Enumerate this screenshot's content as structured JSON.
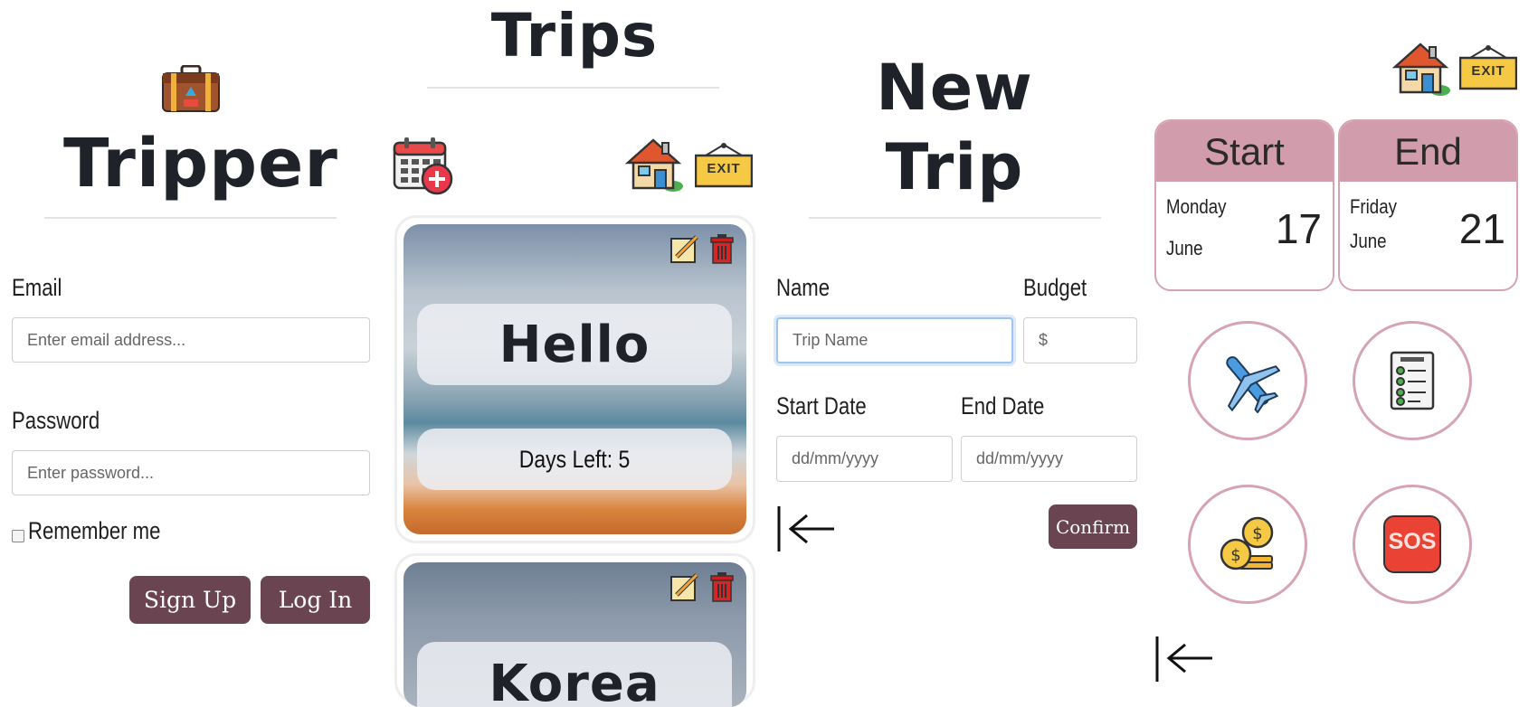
{
  "login": {
    "title": "Tripper",
    "email_label": "Email",
    "email_placeholder": "Enter email address...",
    "password_label": "Password",
    "password_placeholder": "Enter password...",
    "remember_label": "Remember me",
    "signup_label": "Sign Up",
    "login_label": "Log In",
    "logo_icon": "suitcase-icon"
  },
  "trips": {
    "title": "Trips",
    "add_icon": "calendar-add-icon",
    "home_icon": "house-icon",
    "exit_sign": "EXIT",
    "cards": [
      {
        "name": "Hello",
        "days_left": "Days Left: 5"
      },
      {
        "name": "Korea"
      }
    ]
  },
  "new_trip": {
    "title_line1": "New",
    "title_line2": "Trip",
    "name_label": "Name",
    "name_placeholder": "Trip Name",
    "budget_label": "Budget",
    "budget_placeholder": "$",
    "start_label": "Start Date",
    "start_placeholder": "dd/mm/yyyy",
    "end_label": "End Date",
    "end_placeholder": "dd/mm/yyyy",
    "confirm_label": "Confirm"
  },
  "trip_detail": {
    "exit_sign": "EXIT",
    "start": {
      "header": "Start",
      "weekday": "Monday",
      "month": "June",
      "day": "17"
    },
    "end": {
      "header": "End",
      "weekday": "Friday",
      "month": "June",
      "day": "21"
    },
    "actions": [
      "airplane-icon",
      "checklist-icon",
      "coins-icon",
      "sos-icon"
    ],
    "sos_text": "SOS"
  },
  "colors": {
    "accent_button": "#6b4452",
    "date_header": "#d19cab",
    "border_pink": "#d6a3b2"
  }
}
